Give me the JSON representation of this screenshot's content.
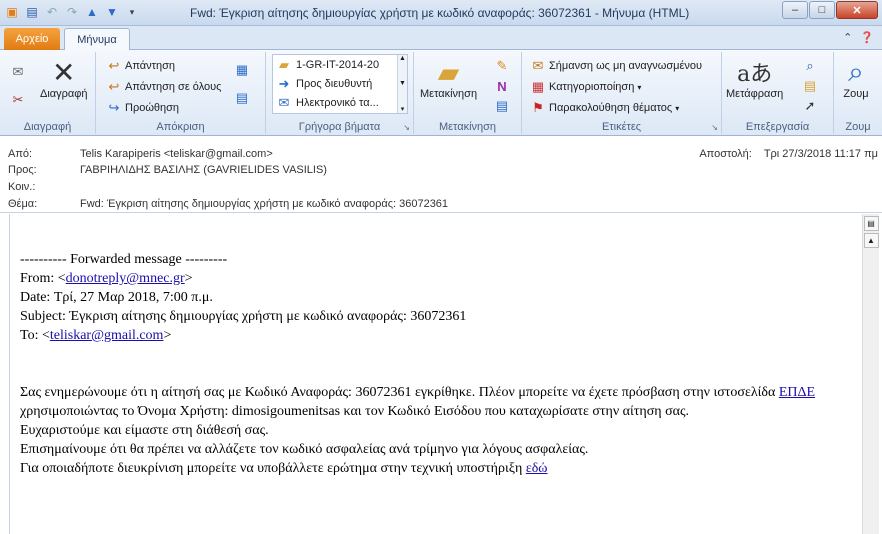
{
  "window": {
    "title": "Fwd: Έγκριση αίτησης δημιουργίας χρήστη με κωδικό αναφοράς: 36072361  -  Μήνυμα (HTML)",
    "minimize": "–",
    "maximize": "□",
    "close": "✕"
  },
  "tabs": {
    "file": "Αρχείο",
    "message": "Μήνυμα"
  },
  "ribbon": {
    "delete_group": {
      "label": "Διαγραφή",
      "delete": "Διαγραφή"
    },
    "respond_group": {
      "label": "Απόκριση",
      "reply": "Απάντηση",
      "reply_all": "Απάντηση σε όλους",
      "forward": "Προώθηση"
    },
    "quick_steps": {
      "label": "Γρήγορα βήματα",
      "items": [
        "1-GR-IT-2014-20",
        "Προς διευθυντή",
        "Ηλεκτρονικό τα..."
      ]
    },
    "move_group": {
      "label": "Μετακίνηση",
      "move": "Μετακίνηση"
    },
    "tags_group": {
      "label": "Ετικέτες",
      "mark_unread": "Σήμανση ως μη αναγνωσμένου",
      "categorize": "Κατηγοριοποίηση",
      "follow_up": "Παρακολούθηση θέματος"
    },
    "editing_group": {
      "label": "Επεξεργασία",
      "translate": "Μετάφραση"
    },
    "zoom_group": {
      "label": "Ζουμ",
      "zoom": "Ζουμ"
    }
  },
  "header": {
    "from_label": "Από:",
    "from_value": "Telis Karapiperis <teliskar@gmail.com>",
    "to_label": "Προς:",
    "to_value": "ΓΑΒΡΙΗΛΙΔΗΣ ΒΑΣΙΛΗΣ (GAVRIELIDES VASILIS)",
    "cc_label": "Κοιν.:",
    "cc_value": "",
    "subject_label": "Θέμα:",
    "subject_value": "Fwd: Έγκριση αίτησης δημιουργίας χρήστη με κωδικό αναφοράς: 36072361",
    "sent_label": "Αποστολή:",
    "sent_value": "Τρι 27/3/2018 11:17 πμ"
  },
  "body": {
    "fwd_line": "---------- Forwarded message ---------",
    "from_prefix": "From: <",
    "from_email": "donotreply@mnec.gr",
    "from_suffix": ">",
    "date_line": "Date: Τρί, 27 Μαρ 2018, 7:00 π.μ.",
    "subject_line": "Subject: Έγκριση αίτησης δημιουργίας χρήστη με κωδικό αναφοράς: 36072361",
    "to_prefix": "To: <",
    "to_email": "teliskar@gmail.com",
    "to_suffix": ">",
    "para1_a": "Σας ενημερώνουμε ότι η αίτησή σας με Κωδικό Αναφοράς: 36072361 εγκρίθηκε. Πλέον μπορείτε να έχετε πρόσβαση στην ιστοσελίδα ",
    "para1_link": "ΕΠΔΕ",
    "para1_b": " χρησιμοποιώντας το Όνομα Χρήστη: dimosigoumenitsas και τον Κωδικό Εισόδου που καταχωρίσατε στην αίτηση σας.",
    "thanks": "Ευχαριστούμε και είμαστε στη διάθεσή σας.",
    "notice": "Επισημαίνουμε ότι θα πρέπει να αλλάζετε τον κωδικό ασφαλείας ανά τρίμηνο για λόγους ασφαλείας.",
    "help_a": "Για οποιαδήποτε διευκρίνιση μπορείτε να υποβάλλετε ερώτημα στην τεχνική υποστήριξη ",
    "help_link": "εδώ"
  }
}
